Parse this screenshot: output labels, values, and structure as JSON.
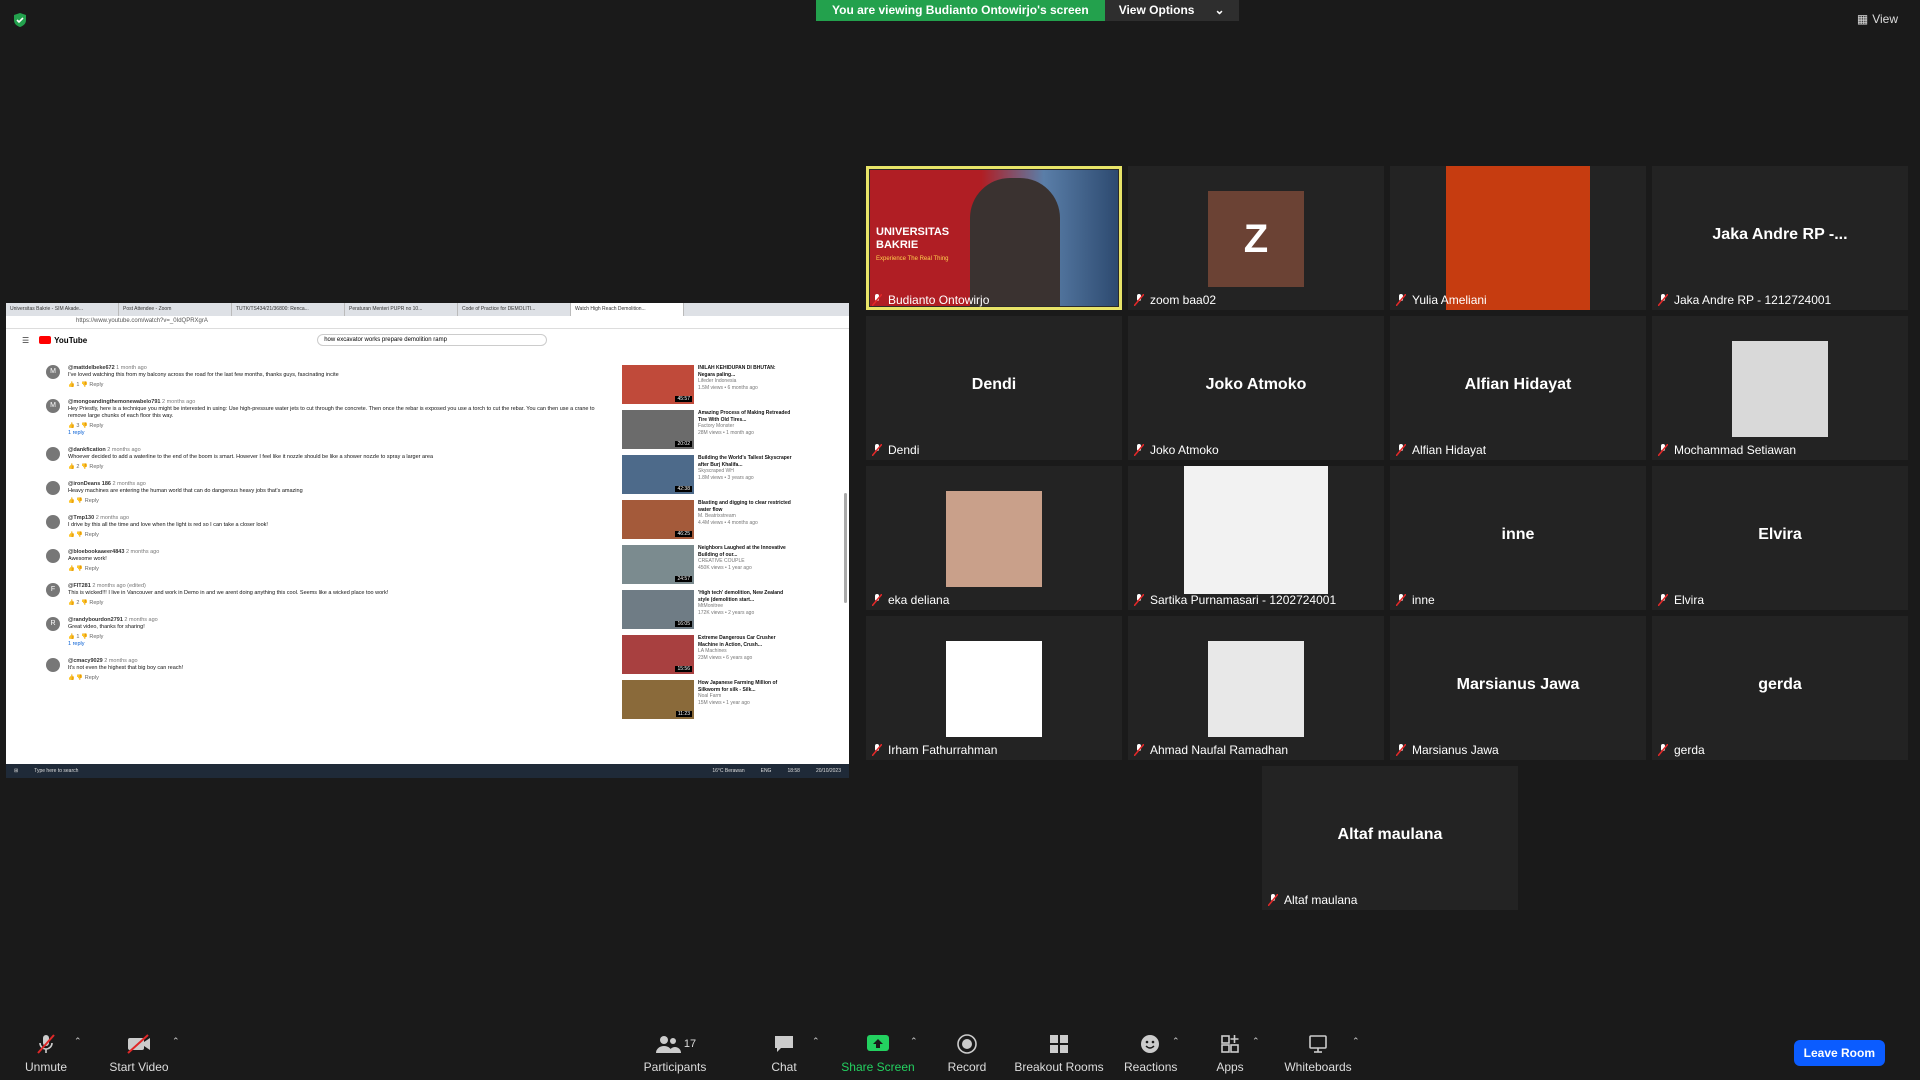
{
  "banner": {
    "message": "You are viewing Budianto Ontowirjo's screen",
    "options_label": "View Options"
  },
  "view_label": "View",
  "share": {
    "tabs": [
      "Universitas Bakrie - SIM Akade...",
      "Post Attendee - Zoom",
      "TUTK/TS434/21/36800: Renca...",
      "Peraturan Menteri PUPR no 10...",
      "Code of Practice for DEMOLITI...",
      "Watch High Reach Demolition..."
    ],
    "url": "https://www.youtube.com/watch?v=_0IdQPRXgrA",
    "search": "how excavator works prepare demolition ramp",
    "comments": [
      {
        "initial": "M",
        "user": "@mattdelbeke672",
        "time": "1 month ago",
        "text": "I've loved watching this from my balcony across the road for the last few months, thanks guys, fascinating incite",
        "likes": "1",
        "extra": ""
      },
      {
        "initial": "M",
        "user": "@mongoandingthemonewabelo791",
        "time": "2 months ago",
        "text": "Hey Priestly, here is a technique you might be interested in using: Use high-pressure water jets to cut through the concrete. Then once the rebar is exposed you use a torch to cut the rebar. You can then use a crane to remove large chunks of each floor this way.",
        "likes": "3",
        "extra": "1 reply"
      },
      {
        "initial": "",
        "user": "@dankfication",
        "time": "2 months ago",
        "text": "Whoever decided to add a waterline to the end of the boom is smart. However I feel like it nozzle should be like a shower nozzle to spray a larger area",
        "likes": "2",
        "extra": ""
      },
      {
        "initial": "",
        "user": "@ironDeans 186",
        "time": "2 months ago",
        "text": "Heavy machines are entering the human world that can do dangerous heavy jobs that's amazing",
        "likes": "",
        "extra": ""
      },
      {
        "initial": "",
        "user": "@Tmp130",
        "time": "2 months ago",
        "text": "I drive by this all the time and love when the light is red so I can take a closer look!",
        "likes": "",
        "extra": ""
      },
      {
        "initial": "",
        "user": "@bloebookaaeer4843",
        "time": "2 months ago",
        "text": "Awesome work!",
        "likes": "",
        "extra": ""
      },
      {
        "initial": "F",
        "user": "@FIT281",
        "time": "2 months ago (edited)",
        "text": "This is wicked!!! I live in Vancouver and work in Demo in and we arent doing anything this cool. Seems like a wicked place too work!",
        "likes": "2",
        "extra": ""
      },
      {
        "initial": "R",
        "user": "@randybourdon2791",
        "time": "2 months ago",
        "text": "Great video, thanks for sharing!",
        "likes": "1",
        "extra": "1 reply"
      },
      {
        "initial": "",
        "user": "@cmacy9029",
        "time": "2 months ago",
        "text": "It's not even the highest that big boy can reach!",
        "likes": "",
        "extra": ""
      }
    ],
    "recommendations": [
      {
        "title": "INILAH KEHIDUPAN DI BHUTAN: Negara paling...",
        "channel": "Lifeder Indonesia",
        "meta": "1.5M views • 6 months ago",
        "duration": "45:57",
        "thumb": "#c04a3a"
      },
      {
        "title": "Amazing Process of Making Retreaded Tire With Old Tires...",
        "channel": "Factory Monster",
        "meta": "28M views • 1 month ago",
        "duration": "20:02",
        "thumb": "#6b6b6b"
      },
      {
        "title": "Building the World's Tallest Skyscraper after Burj Khalifa...",
        "channel": "Skyscraped WH",
        "meta": "1.8M views • 3 years ago",
        "duration": "42:38",
        "thumb": "#4d6a8a"
      },
      {
        "title": "Blasting and digging to clear restricted water flow",
        "channel": "M. Beatrixstream",
        "meta": "4.4M views • 4 months ago",
        "duration": "46:25",
        "thumb": "#a45a3a"
      },
      {
        "title": "Neighbors Laughed at the Innovative Building of our...",
        "channel": "CREATIVE COUPLE",
        "meta": "450K views • 1 year ago",
        "duration": "24:57",
        "thumb": "#7b8b8f"
      },
      {
        "title": "'High tech' demolition, New Zealand style (demolition start...",
        "channel": "MtMonitree",
        "meta": "172K views • 2 years ago",
        "duration": "16:05",
        "thumb": "#6f7c85"
      },
      {
        "title": "Extreme Dangerous Car Crusher Machine in Action, Crush...",
        "channel": "LA Machines",
        "meta": "23M views • 6 years ago",
        "duration": "15:56",
        "thumb": "#a84040"
      },
      {
        "title": "How Japanese Farming Million of Silkworm for silk - Silk...",
        "channel": "Noal Farm",
        "meta": "15M views • 1 year ago",
        "duration": "11:23",
        "thumb": "#8a6a3a"
      }
    ],
    "taskbar_search": "Type here to search",
    "weather": "16°C Berawan",
    "lang": "ENG",
    "time": "18:58",
    "date": "20/10/2023"
  },
  "participants": [
    {
      "name": "Budianto Ontowirjo",
      "display": "",
      "kind": "video",
      "active": true
    },
    {
      "name": "zoom baa02",
      "display": "Z",
      "kind": "avatarZ",
      "active": false
    },
    {
      "name": "Yulia Ameliani",
      "display": "",
      "kind": "orange",
      "active": false
    },
    {
      "name": "Jaka Andre RP - 1212724001",
      "display": "Jaka Andre RP -...",
      "kind": "text",
      "active": false
    },
    {
      "name": "Dendi",
      "display": "Dendi",
      "kind": "text",
      "active": false
    },
    {
      "name": "Joko Atmoko",
      "display": "Joko Atmoko",
      "kind": "text",
      "active": false
    },
    {
      "name": "Alfian Hidayat",
      "display": "Alfian Hidayat",
      "kind": "text",
      "active": false
    },
    {
      "name": "Mochammad Setiawan",
      "display": "",
      "kind": "photo",
      "active": false
    },
    {
      "name": "eka deliana",
      "display": "",
      "kind": "photo",
      "active": false
    },
    {
      "name": "Sartika Purnamasari - 1202724001",
      "display": "",
      "kind": "photoWide",
      "active": false
    },
    {
      "name": "inne",
      "display": "inne",
      "kind": "text",
      "active": false
    },
    {
      "name": "Elvira",
      "display": "Elvira",
      "kind": "text",
      "active": false
    },
    {
      "name": "Irham Fathurrahman",
      "display": "",
      "kind": "photo",
      "active": false
    },
    {
      "name": "Ahmad Naufal Ramadhan",
      "display": "",
      "kind": "photo",
      "active": false
    },
    {
      "name": "Marsianus Jawa",
      "display": "Marsianus Jawa",
      "kind": "text",
      "active": false
    },
    {
      "name": "gerda",
      "display": "gerda",
      "kind": "text",
      "active": false
    },
    {
      "name": "Altaf maulana",
      "display": "Altaf maulana",
      "kind": "text",
      "active": false
    }
  ],
  "video_overlay": {
    "brand": "UNIVERSITAS BAKRIE",
    "tagline": "Experience The Real Thing"
  },
  "toolbar": {
    "unmute": "Unmute",
    "start_video": "Start Video",
    "participants": "Participants",
    "participants_count": "17",
    "chat": "Chat",
    "share_screen": "Share Screen",
    "record": "Record",
    "breakout_rooms": "Breakout Rooms",
    "reactions": "Reactions",
    "apps": "Apps",
    "whiteboards": "Whiteboards",
    "leave": "Leave Room"
  },
  "colors": {
    "banner_green": "#23a14d",
    "active_border": "#e8e468",
    "share_green": "#23d160",
    "leave_blue": "#0b5cff",
    "muted_red": "#e02828"
  }
}
